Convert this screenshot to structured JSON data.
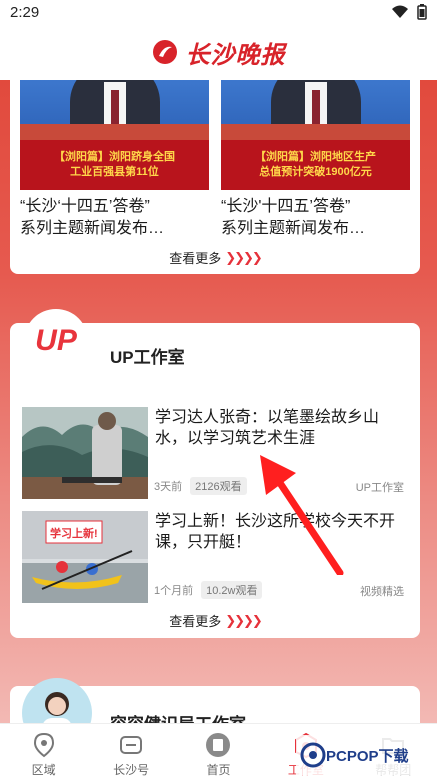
{
  "status_bar": {
    "time": "2:29"
  },
  "header": {
    "app_name": "长沙晚报",
    "brand_color": "#d8232a"
  },
  "news_section": {
    "items": [
      {
        "caption_line1": "【浏阳篇】浏阳跻身全国",
        "caption_line2": "工业百强县第11位",
        "title_line1": "“长沙‘十四五’答卷”",
        "title_line2": "系列主题新闻发布…"
      },
      {
        "caption_line1": "【浏阳篇】浏阳地区生产",
        "caption_line2": "总值预计突破1900亿元",
        "title_line1": "“长沙'十四五’答卷”",
        "title_line2": "系列主题新闻发布…"
      }
    ],
    "more_label": "查看更多"
  },
  "up_section": {
    "logo_text": "UP",
    "title": "UP工作室",
    "videos": [
      {
        "title": "学习达人张奇：以笔墨绘故乡山水，以学习筑艺术生涯",
        "time": "3天前",
        "views": "2126观看",
        "source": "UP工作室"
      },
      {
        "title": "学习上新！长沙这所学校今天不开课，只开艇！",
        "thumb_sign": "学习上新!",
        "time": "1个月前",
        "views": "10.2w观看",
        "source": "视频精选"
      }
    ],
    "more_label": "查看更多"
  },
  "next_section": {
    "title": "容容健识局工作室"
  },
  "tabbar": {
    "tabs": [
      {
        "label": "区域",
        "icon": "location-pin-icon"
      },
      {
        "label": "长沙号",
        "icon": "changsha-hao-icon"
      },
      {
        "label": "首页",
        "icon": "home-book-icon"
      },
      {
        "label": "工作室",
        "icon": "studio-icon",
        "active": true
      },
      {
        "label": "帮帮团",
        "icon": "folder-icon"
      }
    ],
    "active_color": "#e6323b"
  },
  "watermark": {
    "text": "PCPOP下载"
  }
}
